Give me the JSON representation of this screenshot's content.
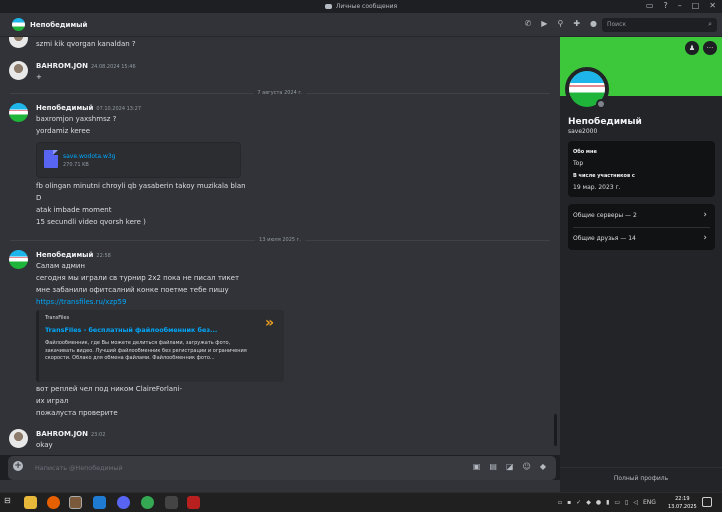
{
  "window": {
    "title": "Личные сообщения"
  },
  "header": {
    "name": "Непобедимый",
    "search_placeholder": "Поиск"
  },
  "messages": {
    "m0": {
      "text": "szmi kik qvorgan kanaldan ?"
    },
    "m1": {
      "author": "BAHROM.JON",
      "time": "24.08.2024 15:46",
      "text": "+"
    },
    "divider1": "7 августа 2024 г.",
    "m2": {
      "author": "Непобедимый",
      "time": "07.10.2024 13:27",
      "lines": [
        "baxromjon yaxshmsz ?",
        "yordamiz keree"
      ],
      "file": {
        "name": "save.wodota.w3g",
        "size": "270.71 KB"
      },
      "lines2": [
        "fb olingan minutni chroyli qb yasaberin takoy muzikala blan",
        "D",
        "atak imbade moment",
        "15 secundli video qvorsh kere )"
      ]
    },
    "divider2": "13 июля 2025 г.",
    "m3": {
      "author": "Непобедимый",
      "time": "22:58",
      "lines": [
        "Салам админ",
        "сегодня мы играли св турнир 2х2 пока не писал тикет",
        "мне забанили офитсалний конке поетме тебе пишу"
      ],
      "link": "https://transfiles.ru/xzp59",
      "embed": {
        "provider": "TransFiles",
        "title": "TransFiles - бесплатный файлообменник без...",
        "description": "Файлообменник, где Вы можете делиться файлами, загружать фото, закачивать видео. Лучший файлообменник без регистрации и ограничения скорости. Облако для обмена файлами. Файлообменник фото..."
      },
      "lines2": [
        "вот реплей чел под ником ClaireForlani-",
        "их играл",
        "пожалуста проверите"
      ]
    },
    "m4": {
      "author": "BAHROM.JON",
      "time": "23:02",
      "text": "okay"
    }
  },
  "composer": {
    "placeholder": "Написать @Непобедимый"
  },
  "profile": {
    "name": "Непобедимый",
    "username": "save2000",
    "about_label": "Обо мне",
    "about_text": "Top",
    "member_since_label": "В числе участников с",
    "member_since": "19 мар. 2023 г.",
    "mutual_servers": "Общие серверы — 2",
    "mutual_friends": "Общие друзья — 14",
    "full_profile": "Полный профиль"
  },
  "taskbar": {
    "lang": "ENG",
    "time": "22:19",
    "date": "13.07.2025"
  },
  "colors": {
    "accent": "#5865f2",
    "link": "#00a8fc",
    "banner": "#3cc83a"
  }
}
